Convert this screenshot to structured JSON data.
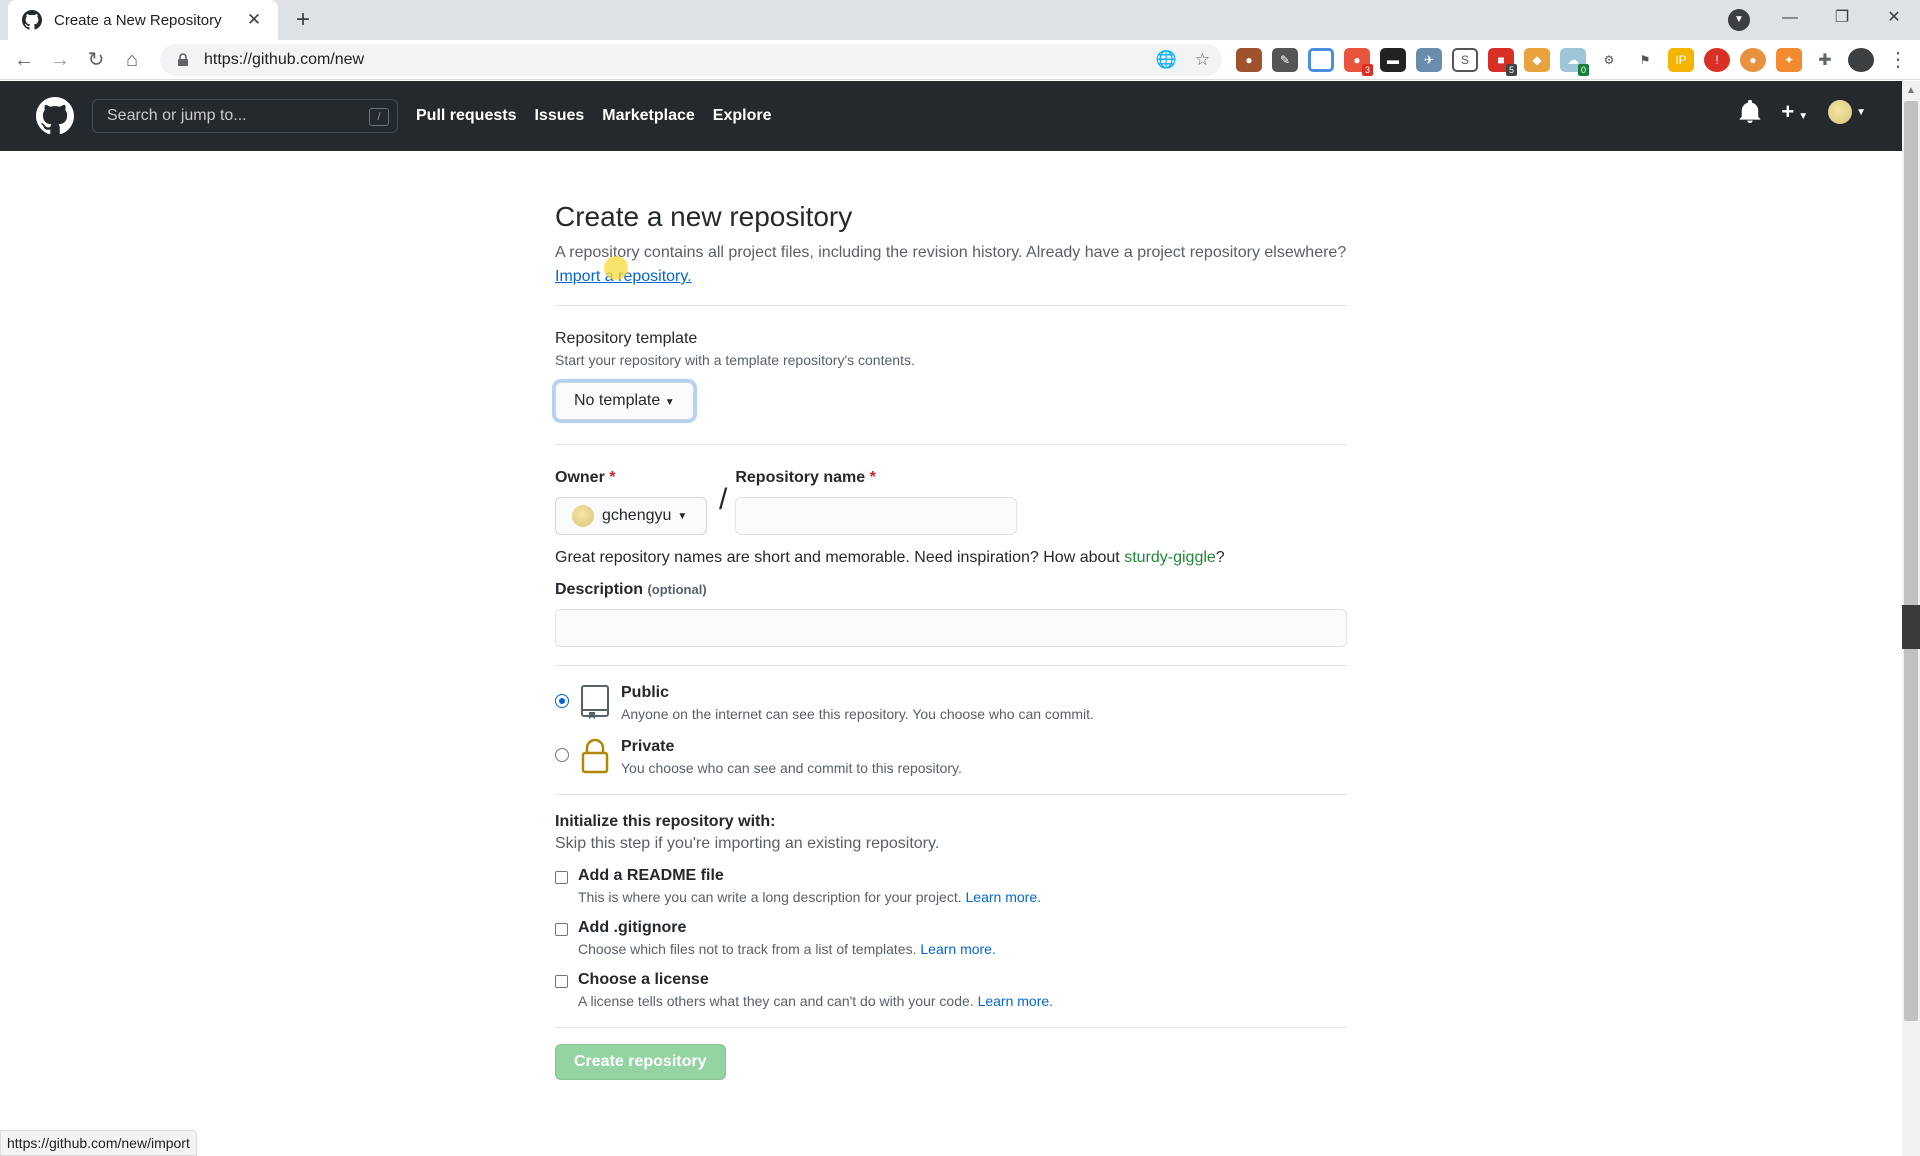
{
  "browser": {
    "tab_title": "Create a New Repository",
    "tab_close": "✕",
    "new_tab": "+",
    "url": "https://github.com/new",
    "window_controls": [
      "—",
      "❐",
      "✕"
    ],
    "extension_badges": [
      "3",
      "5",
      "0"
    ],
    "status_url": "https://github.com/new/import"
  },
  "header": {
    "search_placeholder": "Search or jump to...",
    "search_shortcut": "/",
    "nav": [
      "Pull requests",
      "Issues",
      "Marketplace",
      "Explore"
    ],
    "plus": "+"
  },
  "page": {
    "title": "Create a new repository",
    "lead_text": "A repository contains all project files, including the revision history. Already have a project repository elsewhere?",
    "import_link": "Import a repository.",
    "template": {
      "label": "Repository template",
      "hint": "Start your repository with a template repository's contents.",
      "button": "No template"
    },
    "owner": {
      "label": "Owner",
      "required": "*",
      "value": "gchengyu"
    },
    "separator": "/",
    "repo_name": {
      "label": "Repository name",
      "required": "*",
      "value": ""
    },
    "suggestion": {
      "text": "Great repository names are short and memorable. Need inspiration? How about",
      "name": "sturdy-giggle",
      "end": "?"
    },
    "description": {
      "label": "Description",
      "optional": "(optional)",
      "value": ""
    },
    "visibility": [
      {
        "title": "Public",
        "desc": "Anyone on the internet can see this repository. You choose who can commit.",
        "checked": true
      },
      {
        "title": "Private",
        "desc": "You choose who can see and commit to this repository.",
        "checked": false
      }
    ],
    "init": {
      "title": "Initialize this repository with:",
      "hint": "Skip this step if you're importing an existing repository.",
      "options": [
        {
          "title": "Add a README file",
          "desc": "This is where you can write a long description for your project.",
          "link": "Learn more."
        },
        {
          "title": "Add .gitignore",
          "desc": "Choose which files not to track from a list of templates.",
          "link": "Learn more."
        },
        {
          "title": "Choose a license",
          "desc": "A license tells others what they can and can't do with your code.",
          "link": "Learn more."
        }
      ]
    },
    "create_button": "Create repository"
  },
  "colors": {
    "header_bg": "#24292e",
    "link": "#0366d6",
    "green": "#22863a",
    "create_disabled": "#94d3a2"
  }
}
